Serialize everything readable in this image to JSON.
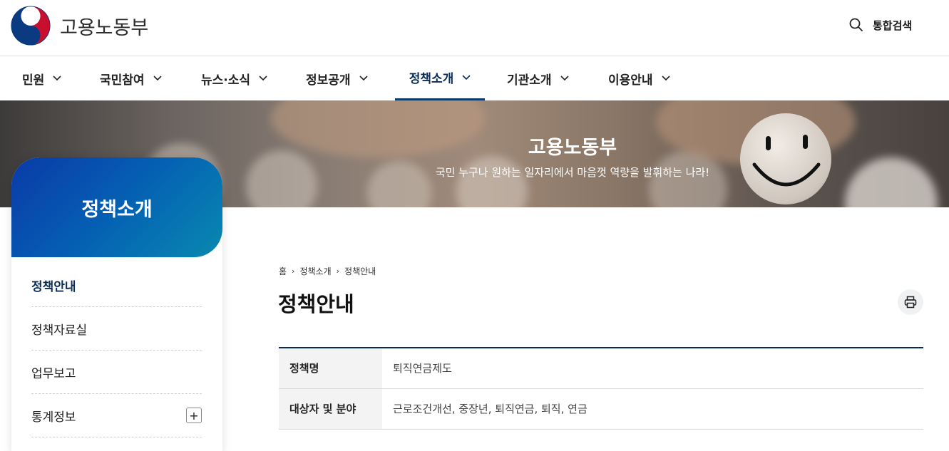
{
  "header": {
    "logo_text": "고용노동부",
    "search_label": "통합검색"
  },
  "gnb": {
    "items": [
      {
        "label": "민원"
      },
      {
        "label": "국민참여"
      },
      {
        "label": "뉴스·소식"
      },
      {
        "label": "정보공개"
      },
      {
        "label": "정책소개",
        "active": true
      },
      {
        "label": "기관소개"
      },
      {
        "label": "이용안내"
      }
    ]
  },
  "banner": {
    "title": "고용노동부",
    "subtitle": "국민 누구나 원하는 일자리에서 마음껏 역량을 발휘하는 나라!"
  },
  "sidebar": {
    "title": "정책소개",
    "items": [
      {
        "label": "정책안내",
        "active": true
      },
      {
        "label": "정책자료실"
      },
      {
        "label": "업무보고"
      },
      {
        "label": "통계정보",
        "expandable": true,
        "expand_symbol": "+"
      }
    ]
  },
  "breadcrumb": {
    "items": [
      "홈",
      "정책소개",
      "정책안내"
    ],
    "separator": "›"
  },
  "main": {
    "title": "정책안내",
    "table": [
      {
        "label": "정책명",
        "value": "퇴직연금제도"
      },
      {
        "label": "대상자 및 분야",
        "value": "근로조건개선, 중장년, 퇴직연금, 퇴직, 연금"
      }
    ]
  },
  "colors": {
    "accent": "#0a2c55",
    "sidebar_gradient_start": "#0a3aa8",
    "sidebar_gradient_end": "#0889b0"
  }
}
